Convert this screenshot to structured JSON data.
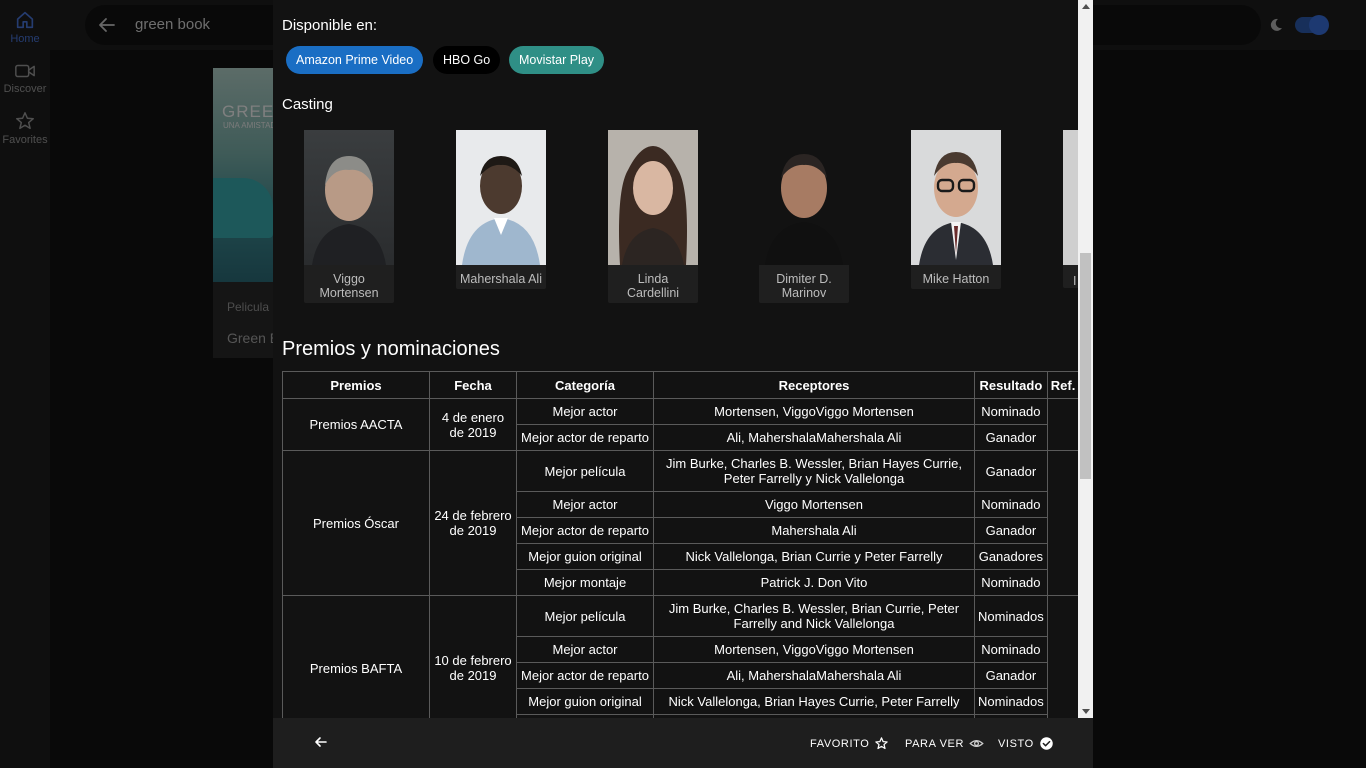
{
  "nav": {
    "items": [
      {
        "label": "Home",
        "icon": "home-icon"
      },
      {
        "label": "Discover",
        "icon": "video-camera-icon"
      },
      {
        "label": "Favorites",
        "icon": "star-icon"
      }
    ]
  },
  "search": {
    "value": "green book"
  },
  "theme": {
    "mode": "dark",
    "toggle_on": true,
    "accent": "#3a72e2"
  },
  "background_page": {
    "poster_title": "GREEN",
    "poster_subtitle": "UNA AMISTAD",
    "type": "Pelicula",
    "title": "Green B"
  },
  "dialog": {
    "available_label": "Disponible en:",
    "providers": [
      {
        "name": "Amazon Prime Video",
        "color": "#1a6ec4"
      },
      {
        "name": "HBO Go",
        "color": "#000000"
      },
      {
        "name": "Movistar Play",
        "color": "#2f8f86"
      }
    ],
    "casting_label": "Casting",
    "cast": [
      {
        "name": "Viggo Mortensen"
      },
      {
        "name": "Mahershala Ali"
      },
      {
        "name": "Linda Cardellini"
      },
      {
        "name": "Dimiter D. Marinov"
      },
      {
        "name": "Mike Hatton"
      },
      {
        "name": "I"
      }
    ],
    "awards_title": "Premios y nominaciones",
    "awards_headers": [
      "Premios",
      "Fecha",
      "Categoría",
      "Receptores",
      "Resultado",
      "Ref."
    ],
    "award_groups": [
      {
        "award": "Premios AACTA",
        "date": "4 de enero de 2019",
        "rows": [
          {
            "category": "Mejor actor",
            "recipients": "Mortensen, ViggoViggo Mortensen",
            "result": "Nominado"
          },
          {
            "category": "Mejor actor de reparto",
            "recipients": "Ali, MahershalaMahershala Ali",
            "result": "Ganador"
          }
        ]
      },
      {
        "award": "Premios Óscar",
        "date": "24 de febrero de 2019",
        "rows": [
          {
            "category": "Mejor película",
            "recipients": "Jim Burke, Charles B. Wessler, Brian Hayes Currie, Peter Farrelly y Nick Vallelonga",
            "result": "Ganador"
          },
          {
            "category": "Mejor actor",
            "recipients": "Viggo Mortensen",
            "result": "Nominado"
          },
          {
            "category": "Mejor actor de reparto",
            "recipients": "Mahershala Ali",
            "result": "Ganador"
          },
          {
            "category": "Mejor guion original",
            "recipients": "Nick Vallelonga, Brian Currie y Peter Farrelly",
            "result": "Ganadores"
          },
          {
            "category": "Mejor montaje",
            "recipients": "Patrick J. Don Vito",
            "result": "Nominado"
          }
        ]
      },
      {
        "award": "Premios BAFTA",
        "date": "10 de febrero de 2019",
        "rows": [
          {
            "category": "Mejor película",
            "recipients": "Jim Burke, Charles B. Wessler, Brian Currie, Peter Farrelly and Nick Vallelonga",
            "result": "Nominados"
          },
          {
            "category": "Mejor actor",
            "recipients": "Mortensen, ViggoViggo Mortensen",
            "result": "Nominado"
          },
          {
            "category": "Mejor actor de reparto",
            "recipients": "Ali, MahershalaMahershala Ali",
            "result": "Ganador"
          },
          {
            "category": "Mejor guion original",
            "recipients": "Nick Vallelonga, Brian Hayes Currie, Peter Farrelly",
            "result": "Nominados"
          }
        ]
      }
    ]
  },
  "footer": {
    "favorite_label": "FAVORITO",
    "to_watch_label": "PARA VER",
    "watched_label": "VISTO"
  }
}
